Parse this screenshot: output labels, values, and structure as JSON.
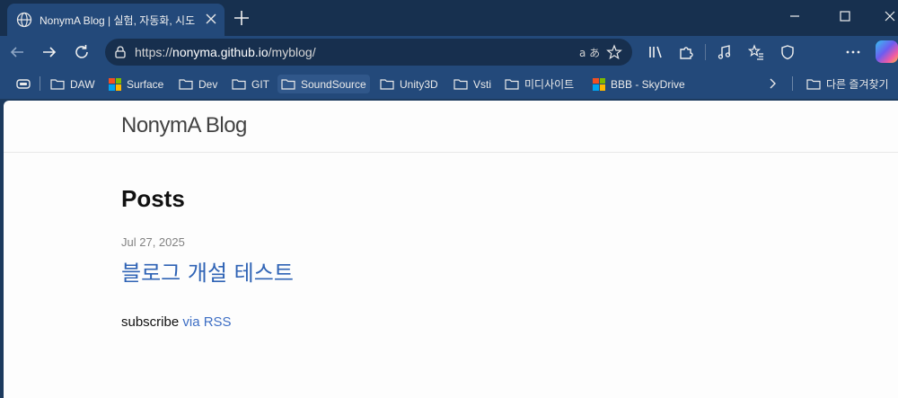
{
  "browser": {
    "tab_title": "NonymA Blog | 실험, 자동화, 시도",
    "url_prefix": "https://",
    "url_host": "nonyma.github.io",
    "url_path": "/myblog/",
    "read_aloud_label": "a あ",
    "favorites": [
      {
        "label": "DAW",
        "icon": "folder-icon"
      },
      {
        "label": "Surface",
        "icon": "microsoft-logo-icon"
      },
      {
        "label": "Dev",
        "icon": "folder-icon"
      },
      {
        "label": "GIT",
        "icon": "folder-icon"
      },
      {
        "label": "SoundSource",
        "icon": "folder-icon"
      },
      {
        "label": "Unity3D",
        "icon": "folder-icon"
      },
      {
        "label": "Vsti",
        "icon": "folder-icon"
      },
      {
        "label": "미디사이트",
        "icon": "folder-icon"
      },
      {
        "label": "BBB - SkyDrive",
        "icon": "microsoft-logo-icon"
      },
      {
        "label": "다른 즐겨찾기",
        "icon": "folder-icon"
      }
    ]
  },
  "page": {
    "site_title": "NonymA Blog",
    "posts_heading": "Posts",
    "posts": [
      {
        "date": "Jul 27, 2025",
        "title": "블로그 개설 테스트"
      }
    ],
    "subscribe_text": "subscribe ",
    "rss_link": "via RSS"
  },
  "colors": {
    "tab_strip": "#17304f",
    "toolbar": "#23497a",
    "link": "#2f63b5"
  }
}
